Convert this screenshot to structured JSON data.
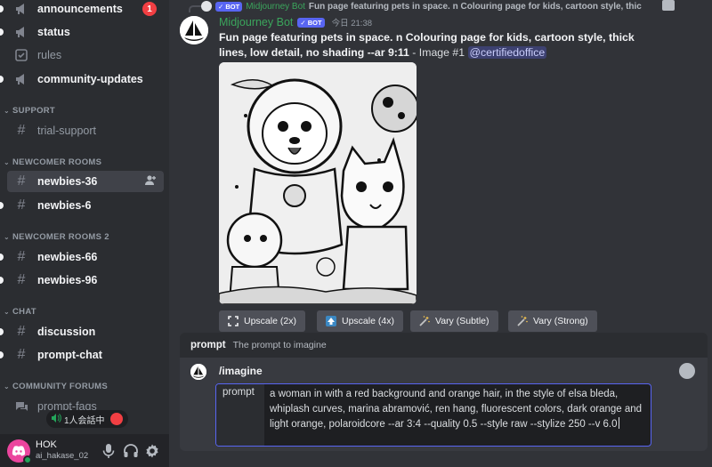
{
  "sidebar": {
    "channels_top": [
      {
        "name": "announcements",
        "badge": "1",
        "icon": "megaphone-icon"
      },
      {
        "name": "status",
        "icon": "megaphone-icon"
      },
      {
        "name": "rules",
        "icon": "checkbox-icon"
      },
      {
        "name": "community-updates",
        "icon": "megaphone-icon"
      }
    ],
    "support": {
      "title": "SUPPORT",
      "channels": [
        {
          "name": "trial-support"
        }
      ]
    },
    "newcomer": {
      "title": "NEWCOMER ROOMS",
      "channels": [
        {
          "name": "newbies-36",
          "selected": true
        },
        {
          "name": "newbies-6"
        }
      ]
    },
    "newcomer2": {
      "title": "NEWCOMER ROOMS 2",
      "channels": [
        {
          "name": "newbies-66"
        },
        {
          "name": "newbies-96"
        }
      ]
    },
    "chat": {
      "title": "CHAT",
      "channels": [
        {
          "name": "discussion"
        },
        {
          "name": "prompt-chat"
        }
      ]
    },
    "forums": {
      "title": "COMMUNITY FORUMS",
      "channels": [
        {
          "name": "prompt-faqs"
        }
      ]
    },
    "voice_pill": {
      "count": "1人会話中"
    },
    "user": {
      "name": "HOK",
      "tag": "ai_hakase_02"
    }
  },
  "reply": {
    "author": "Midjourney Bot",
    "bot_label": "BOT",
    "snippet": "Fun page featuring pets in space. n Colouring page for kids, cartoon style, thic"
  },
  "message": {
    "author": "Midjourney Bot",
    "bot_label": "BOT",
    "timestamp": "今日 21:38",
    "prompt_text": "Fun page featuring pets in space. n Colouring page for kids, cartoon style, thick lines, low detail, no shading --ar 9:11",
    "suffix": " - Image #1 ",
    "mention": "@certifiedoffice"
  },
  "buttons": [
    {
      "label": "Upscale (2x)",
      "icon": "expand-icon"
    },
    {
      "label": "Upscale (4x)",
      "icon": "upscale-arrow-icon"
    },
    {
      "label": "Vary (Subtle)",
      "icon": "sparkle-wand-icon"
    },
    {
      "label": "Vary (Strong)",
      "icon": "sparkle-wand-icon"
    }
  ],
  "hint": {
    "option": "prompt",
    "description": "The prompt to imagine"
  },
  "composer": {
    "command": "/imagine",
    "option_label": "prompt",
    "value": "a woman in with a red background and orange hair, in the style of elsa bleda, whiplash curves, marina abramović, ren hang, fluorescent colors, dark orange and light orange, polaroidcore --ar 3:4 --quality 0.5 --style raw --stylize 250 --v 6.0"
  },
  "colors": {
    "accent": "#5865f2",
    "bot_name": "#3ba55c",
    "unread_badge": "#f23f43",
    "sidebar": "#2b2d31",
    "main": "#313338"
  }
}
